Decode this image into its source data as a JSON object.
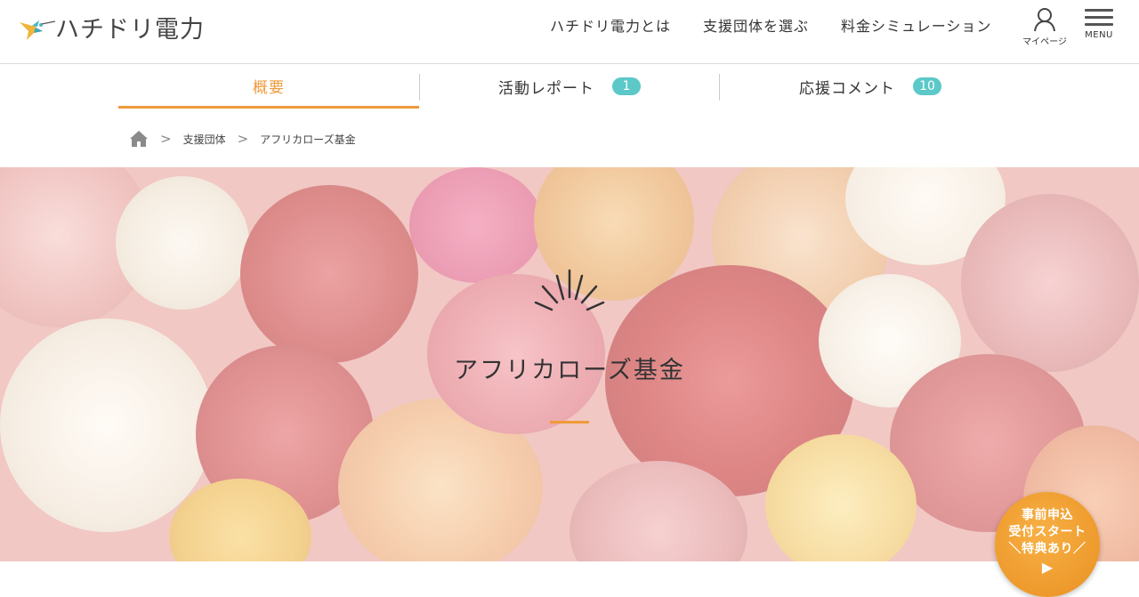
{
  "header": {
    "logo_text": "ハチドリ電力",
    "nav": [
      {
        "label": "ハチドリ電力とは"
      },
      {
        "label": "支援団体を選ぶ"
      },
      {
        "label": "料金シミュレーション"
      }
    ],
    "mypage_label": "マイページ",
    "menu_label": "MENU"
  },
  "tabs": [
    {
      "label": "概要",
      "badge": ""
    },
    {
      "label": "活動レポート",
      "badge": "1"
    },
    {
      "label": "応援コメント",
      "badge": "10"
    }
  ],
  "breadcrumb": {
    "sep": ">",
    "items": [
      "支援団体",
      "アフリカローズ基金"
    ]
  },
  "hero": {
    "title": "アフリカローズ基金"
  },
  "campaign": {
    "lines": [
      "事前申込",
      "受付スタート",
      "＼特典あり／"
    ],
    "arrow": "▶"
  },
  "colors": {
    "accent": "#ef9a3a",
    "badge": "#5cc8c8"
  }
}
